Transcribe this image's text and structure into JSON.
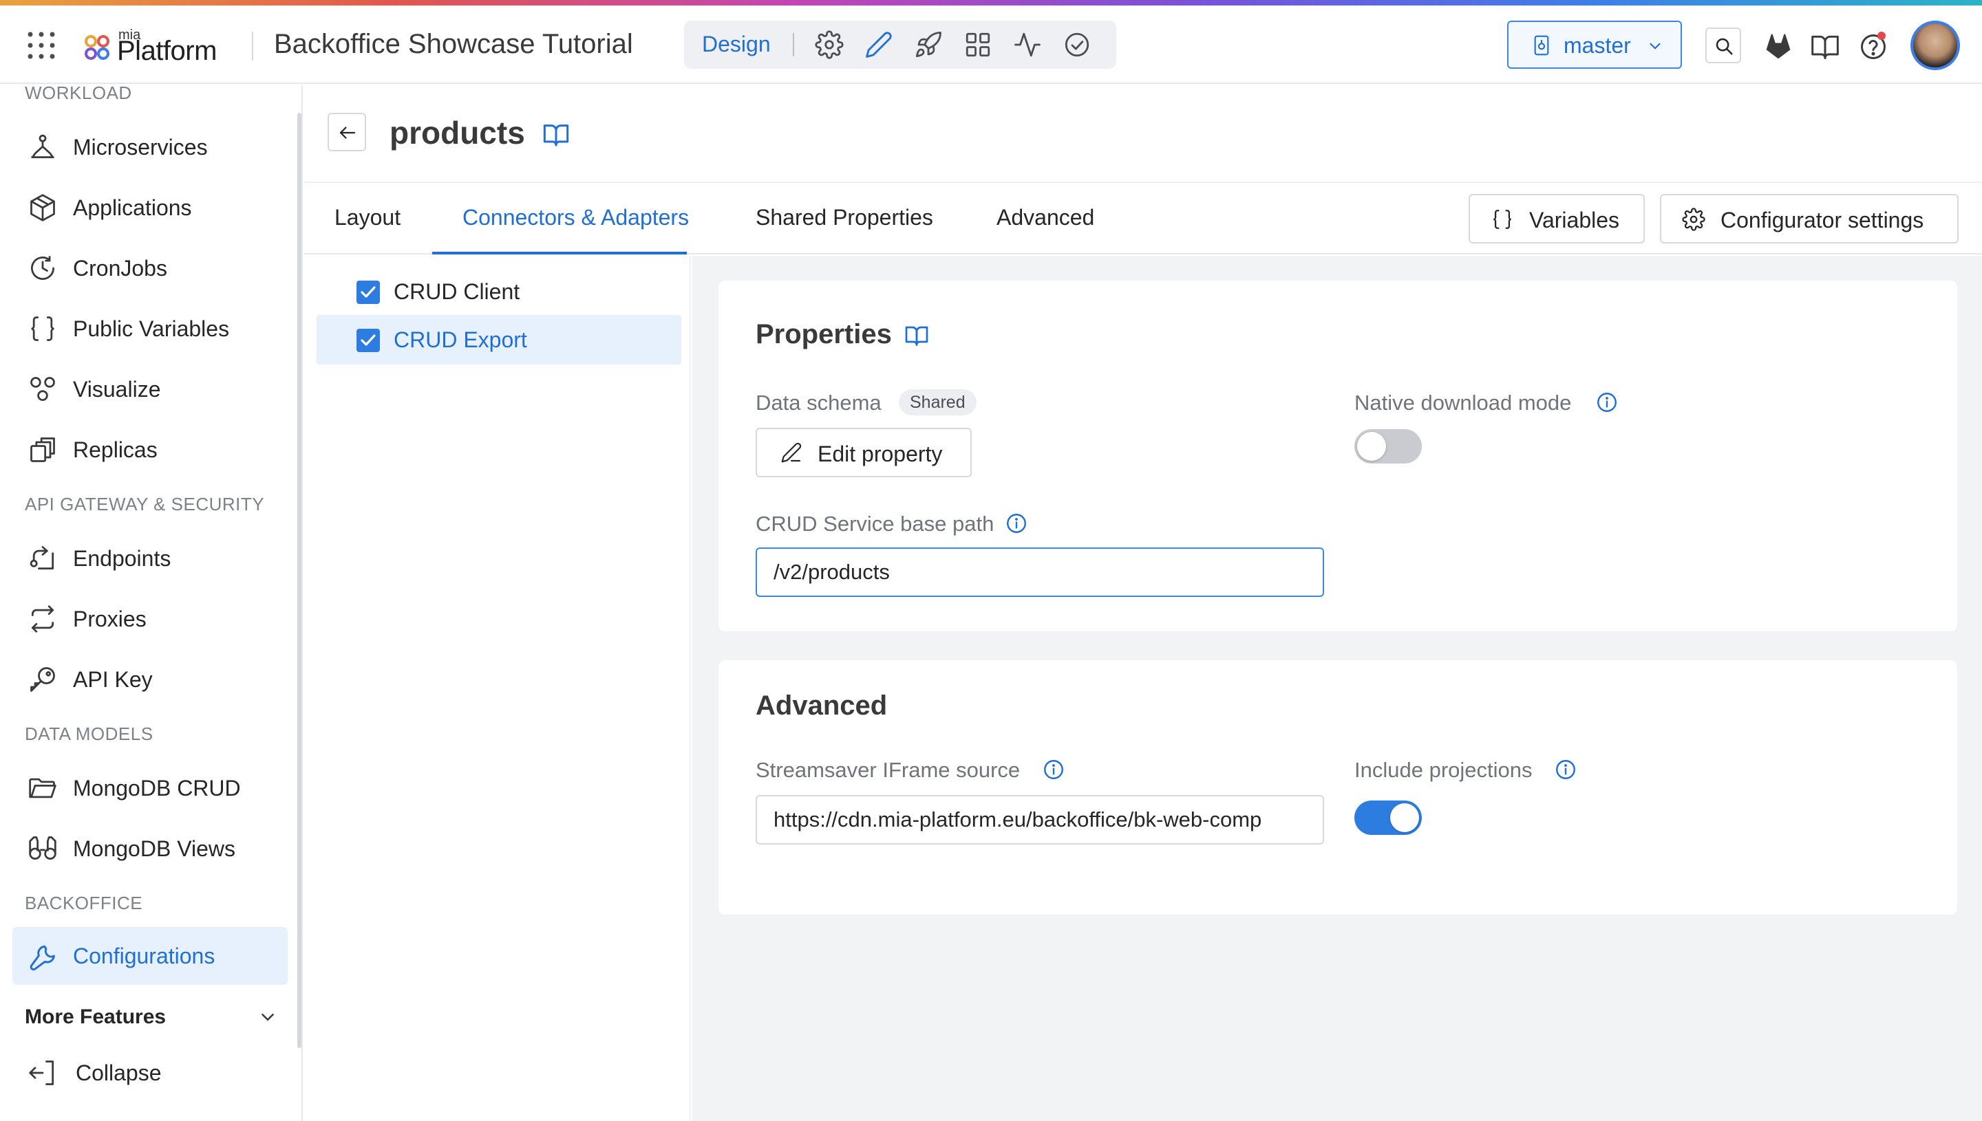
{
  "topbar": {
    "logo_small": "mia",
    "logo_main": "Platform",
    "project_title": "Backoffice Showcase Tutorial",
    "mode_label": "Design",
    "mode_icons": [
      "gear-icon",
      "pencil-icon",
      "rocket-icon",
      "dashboard-icon",
      "activity-icon",
      "check-circle-icon"
    ],
    "branch": "master",
    "right_icons": [
      "search-icon",
      "gitlab-icon",
      "book-icon",
      "help-icon"
    ]
  },
  "sidebar": {
    "sections": [
      {
        "title": "WORKLOAD",
        "items": [
          {
            "label": "Microservices",
            "icon": "microservices-icon"
          },
          {
            "label": "Applications",
            "icon": "package-icon"
          },
          {
            "label": "CronJobs",
            "icon": "clock-icon"
          },
          {
            "label": "Public Variables",
            "icon": "braces-icon"
          },
          {
            "label": "Visualize",
            "icon": "visualize-icon"
          },
          {
            "label": "Replicas",
            "icon": "copy-icon"
          }
        ]
      },
      {
        "title": "API GATEWAY & SECURITY",
        "items": [
          {
            "label": "Endpoints",
            "icon": "endpoint-icon"
          },
          {
            "label": "Proxies",
            "icon": "swap-icon"
          },
          {
            "label": "API Key",
            "icon": "key-icon"
          }
        ]
      },
      {
        "title": "DATA MODELS",
        "items": [
          {
            "label": "MongoDB CRUD",
            "icon": "folder-icon"
          },
          {
            "label": "MongoDB Views",
            "icon": "binoculars-icon"
          }
        ]
      },
      {
        "title": "BACKOFFICE",
        "items": [
          {
            "label": "Configurations",
            "icon": "wrench-icon",
            "active": true
          }
        ]
      }
    ],
    "more_features": "More Features",
    "collapse": "Collapse"
  },
  "page": {
    "title": "products",
    "tabs": [
      "Layout",
      "Connectors & Adapters",
      "Shared Properties",
      "Advanced"
    ],
    "active_tab": "Connectors & Adapters",
    "variables_button": "Variables",
    "settings_button": "Configurator settings"
  },
  "connectors": [
    {
      "label": "CRUD Client",
      "checked": true,
      "selected": false
    },
    {
      "label": "CRUD Export",
      "checked": true,
      "selected": true
    }
  ],
  "properties": {
    "title": "Properties",
    "data_schema_label": "Data schema",
    "data_schema_badge": "Shared",
    "edit_property_button": "Edit property",
    "native_download_label": "Native download mode",
    "native_download_enabled": false,
    "base_path_label": "CRUD Service base path",
    "base_path_value": "/v2/products"
  },
  "advanced": {
    "title": "Advanced",
    "streamsaver_label": "Streamsaver IFrame source",
    "streamsaver_value": "https://cdn.mia-platform.eu/backoffice/bk-web-comp",
    "include_projections_label": "Include projections",
    "include_projections_enabled": true
  },
  "colors": {
    "accent": "#1f6fd6",
    "active_bg": "#e6f1fd",
    "content_bg": "#f2f3f5"
  }
}
